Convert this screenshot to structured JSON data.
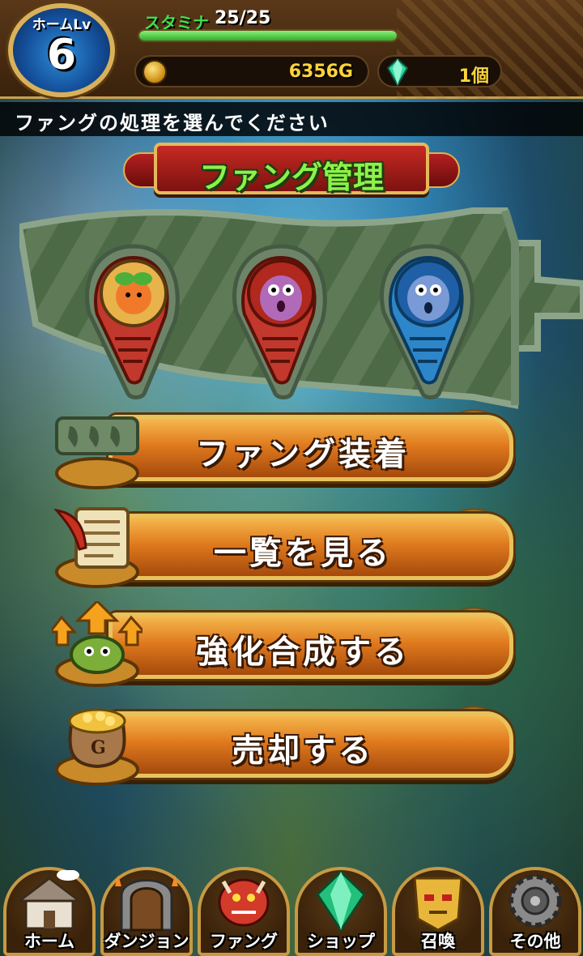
{
  "hud": {
    "level_label": "ホームLv",
    "level_value": "6",
    "stamina_label": "スタミナ",
    "stamina_value": "25/25",
    "stamina_ratio": 1.0,
    "gold_value": "6356G",
    "gem_value": "1個"
  },
  "message": "ファングの処理を選んでください",
  "title": "ファング管理",
  "fangs": [
    {
      "name": "orange-plant-monster",
      "color": "#c8352a"
    },
    {
      "name": "purple-blob-monster",
      "color": "#c8352a"
    },
    {
      "name": "blue-blob-monster",
      "color": "#2a7ac8"
    }
  ],
  "menu": [
    {
      "id": "equip",
      "label": "ファング装着",
      "icon": "fang-rack-icon"
    },
    {
      "id": "list",
      "label": "一覧を見る",
      "icon": "scroll-quill-icon"
    },
    {
      "id": "enhance",
      "label": "強化合成する",
      "icon": "power-up-slime-icon"
    },
    {
      "id": "sell",
      "label": "売却する",
      "icon": "gold-bag-icon"
    }
  ],
  "nav": [
    {
      "id": "home",
      "label": "ホーム",
      "icon": "house-icon"
    },
    {
      "id": "dungeon",
      "label": "ダンジョン",
      "icon": "dungeon-gate-icon"
    },
    {
      "id": "fang",
      "label": "ファング",
      "icon": "red-dragon-icon"
    },
    {
      "id": "shop",
      "label": "ショップ",
      "icon": "green-gem-icon"
    },
    {
      "id": "summon",
      "label": "召喚",
      "icon": "golden-mask-icon"
    },
    {
      "id": "other",
      "label": "その他",
      "icon": "gear-icon"
    }
  ],
  "colors": {
    "stamina_green": "#3de04d",
    "gold_text": "#ffd43a",
    "title_green": "#8cf24a",
    "button_orange": "#e07a1e"
  }
}
